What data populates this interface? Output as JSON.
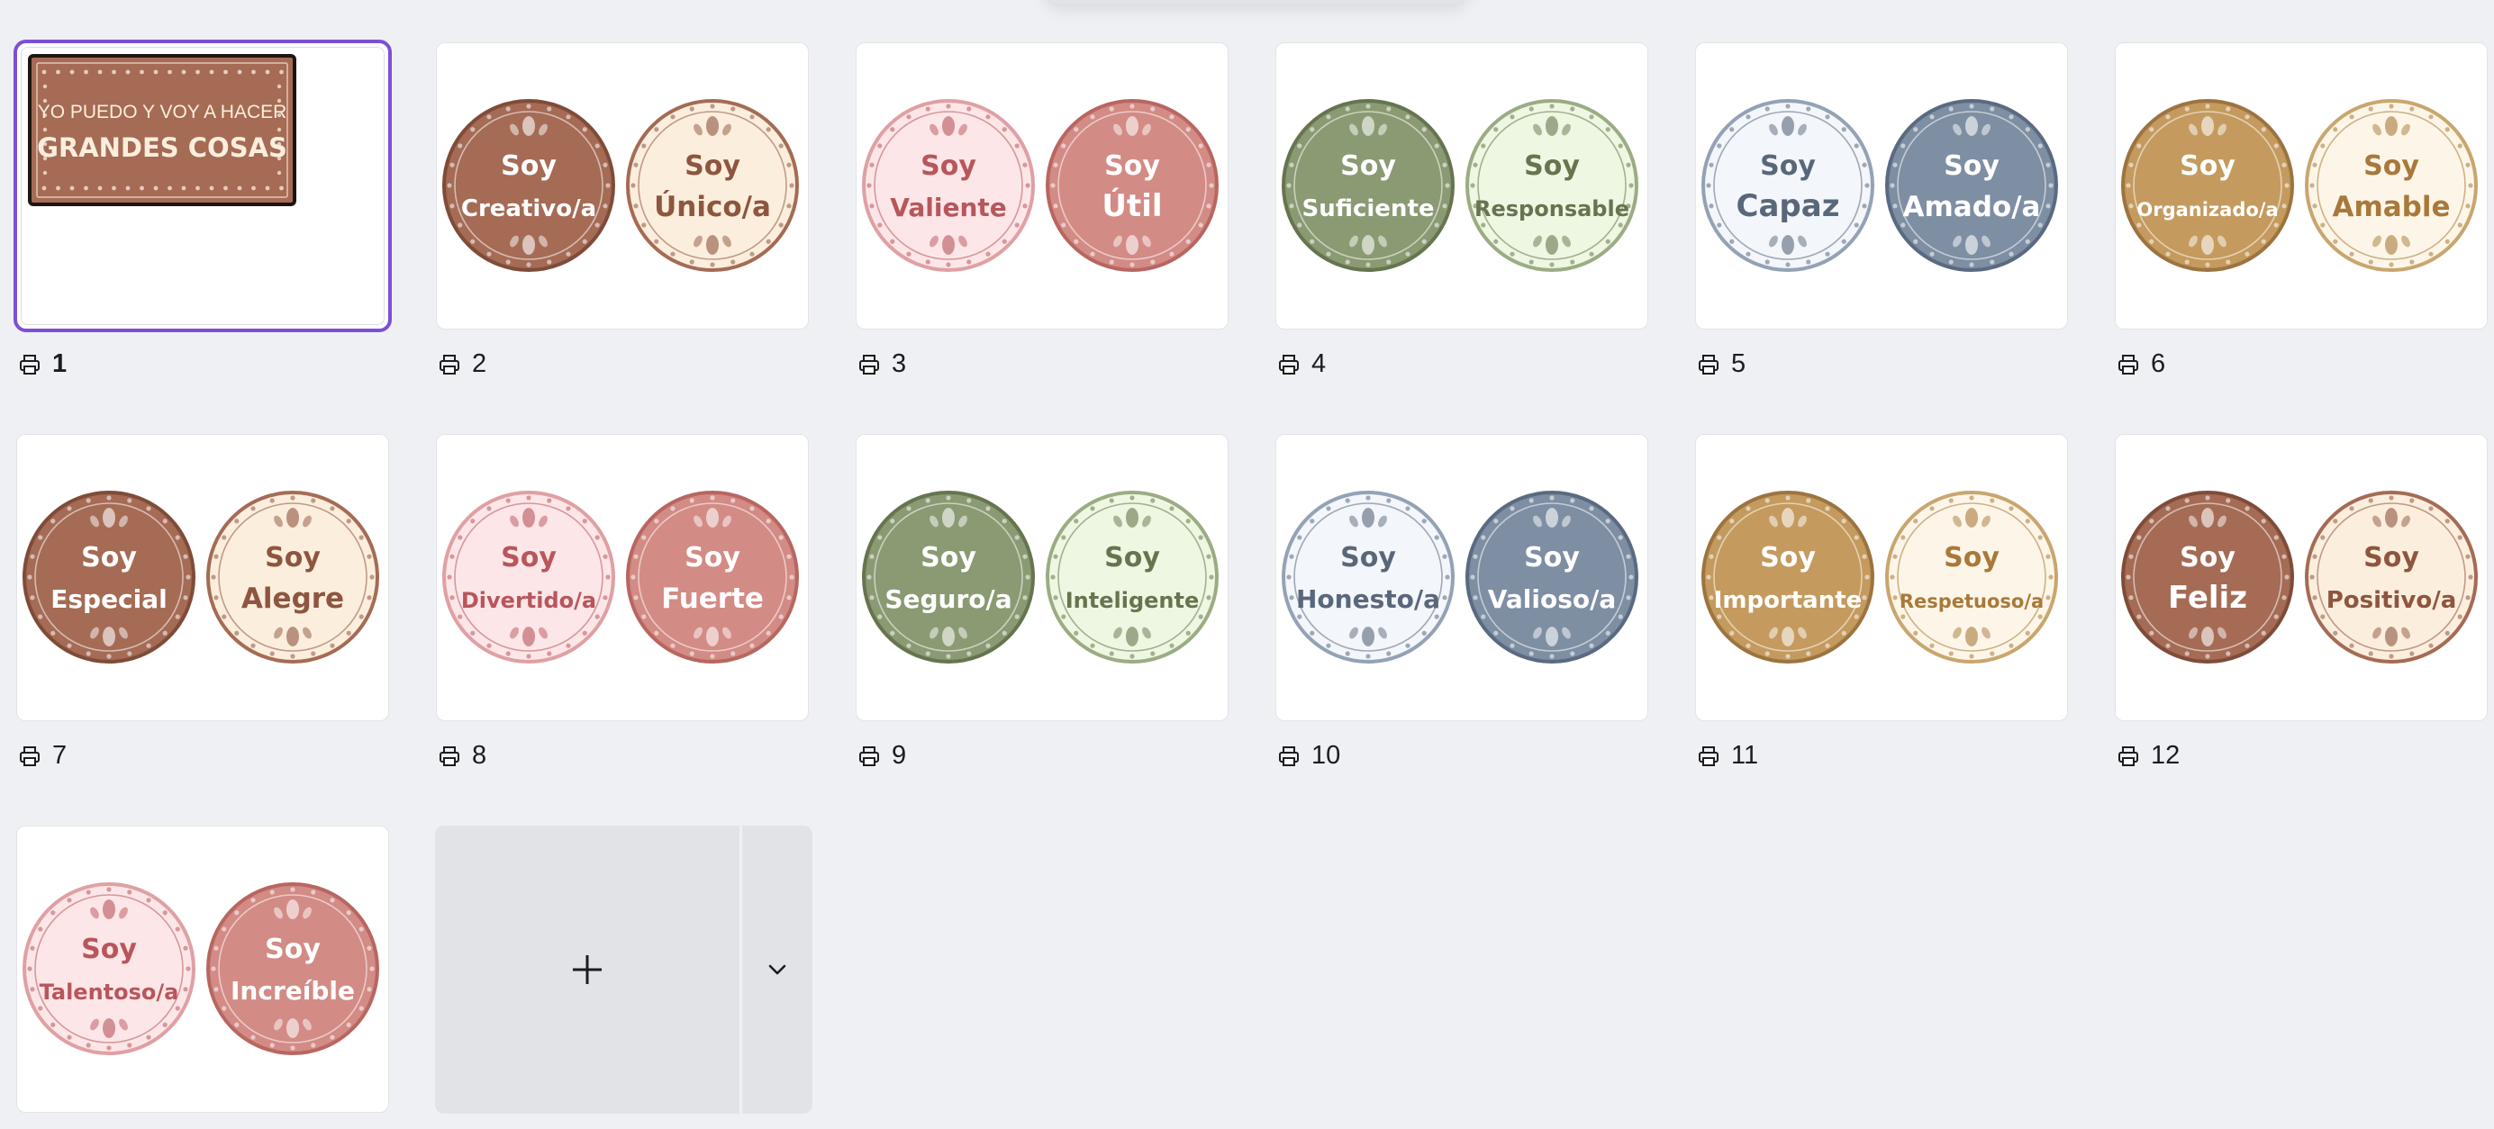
{
  "title_page": {
    "line1": "YO PUEDO Y VOY A HACER",
    "line2": "GRANDES COSAS",
    "bg": "#a56b55",
    "frame": "#1e1512"
  },
  "pages": [
    {
      "number": "1",
      "active": true
    },
    {
      "number": "2",
      "stickers": [
        {
          "word1": "Soy",
          "word2": "Creativo/a",
          "bg": "#a56b55",
          "ring": "#7e4c39",
          "text": "#ffffff"
        },
        {
          "word1": "Soy",
          "word2": "Único/a",
          "bg": "#fbeedd",
          "ring": "#a56b55",
          "text": "#8e553f"
        }
      ]
    },
    {
      "number": "3",
      "stickers": [
        {
          "word1": "Soy",
          "word2": "Valiente",
          "bg": "#fde6e8",
          "ring": "#dfa0a4",
          "text": "#b8565b"
        },
        {
          "word1": "Soy",
          "word2": "Útil",
          "bg": "#d38b85",
          "ring": "#b86661",
          "text": "#ffffff"
        }
      ]
    },
    {
      "number": "4",
      "stickers": [
        {
          "word1": "Soy",
          "word2": "Suficiente",
          "bg": "#8a9a72",
          "ring": "#66744f",
          "text": "#ffffff"
        },
        {
          "word1": "Soy",
          "word2": "Responsable",
          "bg": "#eef7e1",
          "ring": "#9bac84",
          "text": "#66744f"
        }
      ]
    },
    {
      "number": "5",
      "stickers": [
        {
          "word1": "Soy",
          "word2": "Capaz",
          "bg": "#f3f6fb",
          "ring": "#93a2b4",
          "text": "#59677a"
        },
        {
          "word1": "Soy",
          "word2": "Amado/a",
          "bg": "#7e8ea3",
          "ring": "#5a6a80",
          "text": "#ffffff"
        }
      ]
    },
    {
      "number": "6",
      "stickers": [
        {
          "word1": "Soy",
          "word2": "Organizado/a",
          "bg": "#c49a5e",
          "ring": "#9c7440",
          "text": "#ffffff"
        },
        {
          "word1": "Soy",
          "word2": "Amable",
          "bg": "#fdf6e8",
          "ring": "#c9a66e",
          "text": "#a8793b"
        }
      ]
    },
    {
      "number": "7",
      "stickers": [
        {
          "word1": "Soy",
          "word2": "Especial",
          "bg": "#a56b55",
          "ring": "#7e4c39",
          "text": "#ffffff"
        },
        {
          "word1": "Soy",
          "word2": "Alegre",
          "bg": "#fbeedd",
          "ring": "#a56b55",
          "text": "#8e553f"
        }
      ]
    },
    {
      "number": "8",
      "stickers": [
        {
          "word1": "Soy",
          "word2": "Divertido/a",
          "bg": "#fde6e8",
          "ring": "#dfa0a4",
          "text": "#b8565b"
        },
        {
          "word1": "Soy",
          "word2": "Fuerte",
          "bg": "#d38b85",
          "ring": "#b86661",
          "text": "#ffffff"
        }
      ]
    },
    {
      "number": "9",
      "stickers": [
        {
          "word1": "Soy",
          "word2": "Seguro/a",
          "bg": "#8a9a72",
          "ring": "#66744f",
          "text": "#ffffff"
        },
        {
          "word1": "Soy",
          "word2": "Inteligente",
          "bg": "#eef7e1",
          "ring": "#9bac84",
          "text": "#66744f"
        }
      ]
    },
    {
      "number": "10",
      "stickers": [
        {
          "word1": "Soy",
          "word2": "Honesto/a",
          "bg": "#f3f6fb",
          "ring": "#93a2b4",
          "text": "#59677a"
        },
        {
          "word1": "Soy",
          "word2": "Valioso/a",
          "bg": "#7e8ea3",
          "ring": "#5a6a80",
          "text": "#ffffff"
        }
      ]
    },
    {
      "number": "11",
      "stickers": [
        {
          "word1": "Soy",
          "word2": "Importante",
          "bg": "#c49a5e",
          "ring": "#9c7440",
          "text": "#ffffff"
        },
        {
          "word1": "Soy",
          "word2": "Respetuoso/a",
          "bg": "#fdf6e8",
          "ring": "#c9a66e",
          "text": "#a8793b"
        }
      ]
    },
    {
      "number": "12",
      "stickers": [
        {
          "word1": "Soy",
          "word2": "Feliz",
          "bg": "#a56b55",
          "ring": "#7e4c39",
          "text": "#ffffff"
        },
        {
          "word1": "Soy",
          "word2": "Positivo/a",
          "bg": "#fbeedd",
          "ring": "#a56b55",
          "text": "#8e553f"
        }
      ]
    },
    {
      "number": "",
      "stickers": [
        {
          "word1": "Soy",
          "word2": "Talentoso/a",
          "bg": "#fde6e8",
          "ring": "#dfa0a4",
          "text": "#b8565b"
        },
        {
          "word1": "Soy",
          "word2": "Increíble",
          "bg": "#d38b85",
          "ring": "#b86661",
          "text": "#ffffff"
        }
      ]
    }
  ],
  "add_page": {
    "plus_icon": "plus-icon",
    "more_icon": "chevron-down-icon"
  },
  "colors": {
    "selection": "#7d4fd4",
    "canvas": "#eff0f4"
  }
}
